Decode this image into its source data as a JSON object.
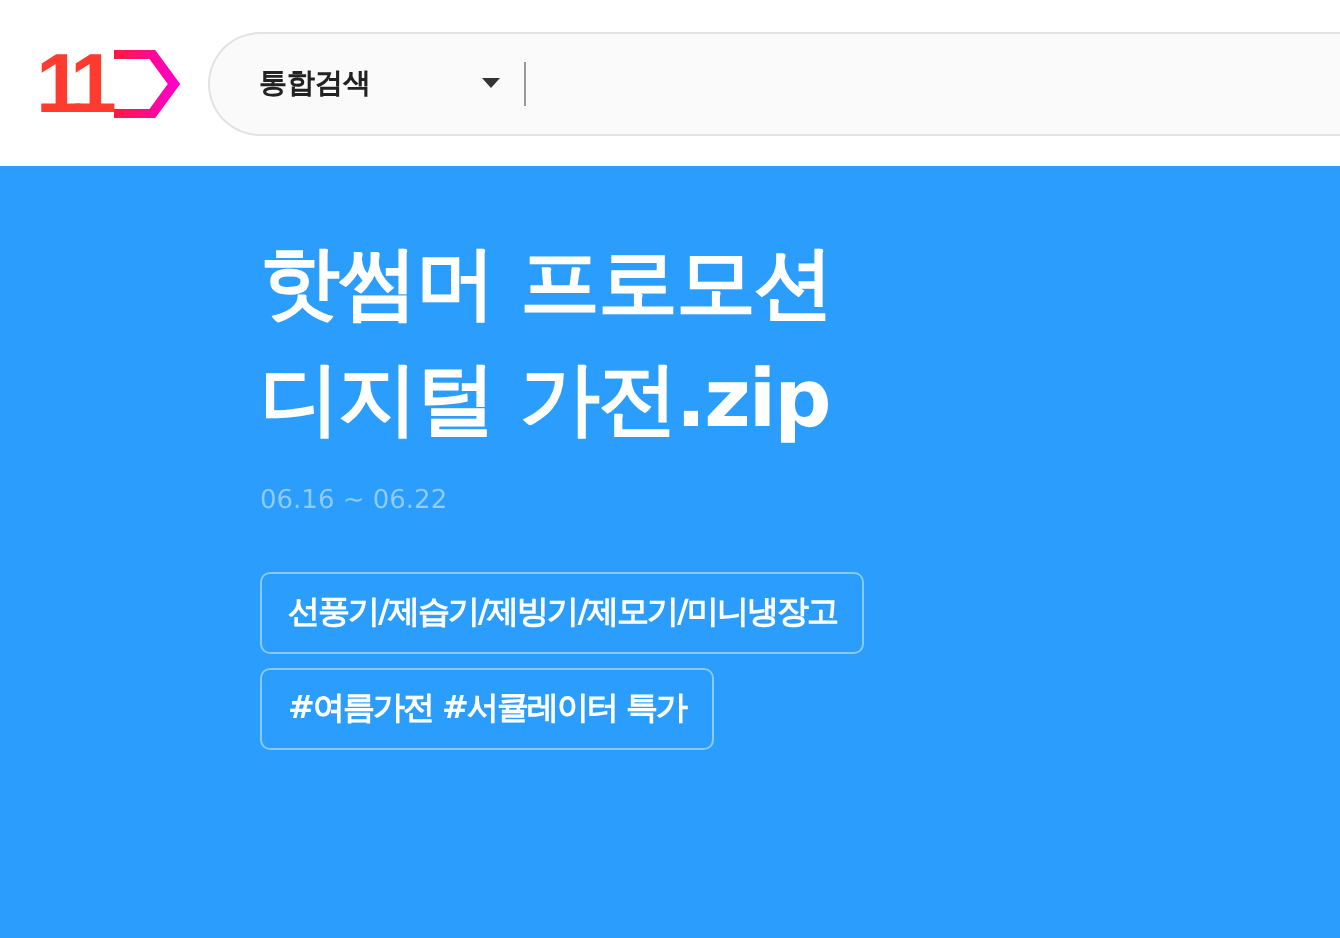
{
  "header": {
    "logo": {
      "text": "11"
    },
    "search": {
      "scope": "통합검색"
    }
  },
  "banner": {
    "title_lines": [
      "핫썸머 프로모션",
      "디지털 가전.zip"
    ],
    "period": "06.16 ~ 06.22",
    "tags": [
      "선풍기/제습기/제빙기/제모기/미니냉장고",
      "#여름가전 #서큘레이터 특가"
    ]
  }
}
